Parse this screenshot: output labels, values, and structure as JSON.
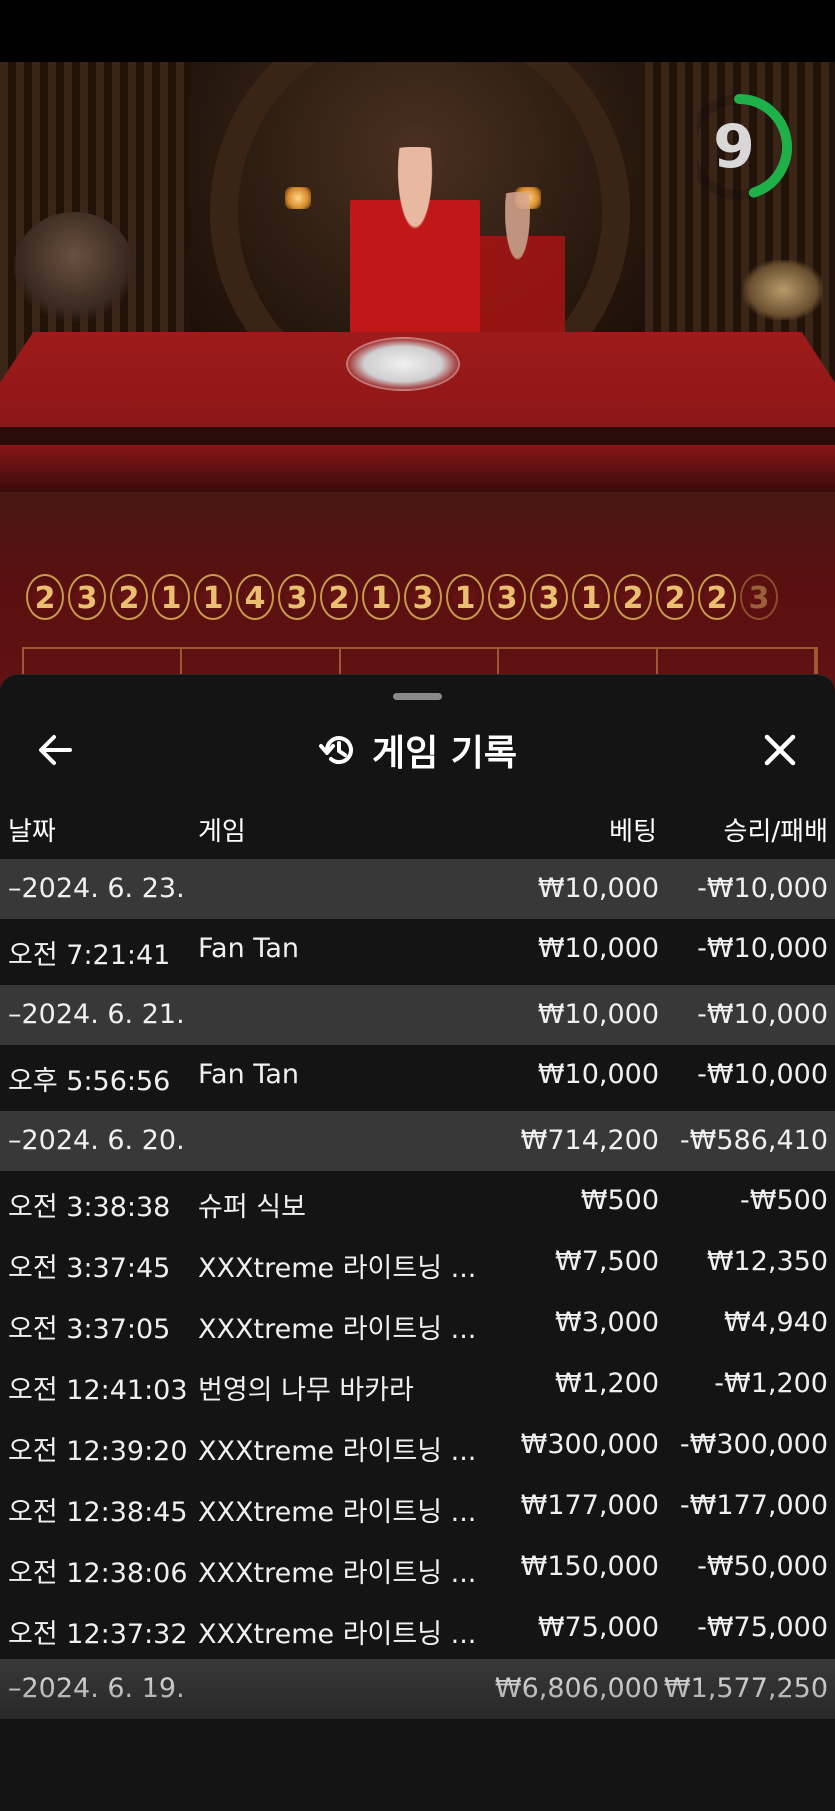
{
  "timer": {
    "value": "9",
    "fraction": 0.45,
    "color": "#1fb04a"
  },
  "road": [
    "2",
    "3",
    "2",
    "1",
    "1",
    "4",
    "3",
    "2",
    "1",
    "3",
    "1",
    "3",
    "3",
    "1",
    "2",
    "2",
    "2",
    "3"
  ],
  "sheet": {
    "title": "게임 기록",
    "back_icon": "arrow-left-icon",
    "title_icon": "history-icon",
    "close_icon": "close-icon",
    "columns": {
      "date": "날짜",
      "game": "게임",
      "bet": "베팅",
      "win_loss": "승리/패배"
    },
    "rows": [
      {
        "type": "day",
        "time": "–2024. 6. 23.",
        "game": "",
        "bet": "₩10,000",
        "win": "-₩10,000"
      },
      {
        "type": "entry",
        "time": "오전 7:21:41",
        "game": "Fan Tan",
        "bet": "₩10,000",
        "win": "-₩10,000"
      },
      {
        "type": "day",
        "time": "–2024. 6. 21.",
        "game": "",
        "bet": "₩10,000",
        "win": "-₩10,000"
      },
      {
        "type": "entry",
        "time": "오후 5:56:56",
        "game": "Fan Tan",
        "bet": "₩10,000",
        "win": "-₩10,000"
      },
      {
        "type": "day",
        "time": "–2024. 6. 20.",
        "game": "",
        "bet": "₩714,200",
        "win": "-₩586,410"
      },
      {
        "type": "entry",
        "time": "오전 3:38:38",
        "game": "슈퍼 식보",
        "bet": "₩500",
        "win": "-₩500"
      },
      {
        "type": "entry",
        "time": "오전 3:37:45",
        "game": "XXXtreme 라이트닝 ...",
        "bet": "₩7,500",
        "win": "₩12,350"
      },
      {
        "type": "entry",
        "time": "오전 3:37:05",
        "game": "XXXtreme 라이트닝 ...",
        "bet": "₩3,000",
        "win": "₩4,940"
      },
      {
        "type": "entry",
        "time": "오전 12:41:03",
        "game": "번영의 나무 바카라",
        "bet": "₩1,200",
        "win": "-₩1,200"
      },
      {
        "type": "entry",
        "time": "오전 12:39:20",
        "game": "XXXtreme 라이트닝 ...",
        "bet": "₩300,000",
        "win": "-₩300,000"
      },
      {
        "type": "entry",
        "time": "오전 12:38:45",
        "game": "XXXtreme 라이트닝 ...",
        "bet": "₩177,000",
        "win": "-₩177,000"
      },
      {
        "type": "entry",
        "time": "오전 12:38:06",
        "game": "XXXtreme 라이트닝 ...",
        "bet": "₩150,000",
        "win": "-₩50,000"
      },
      {
        "type": "entry",
        "time": "오전 12:37:32",
        "game": "XXXtreme 라이트닝 ...",
        "bet": "₩75,000",
        "win": "-₩75,000"
      },
      {
        "type": "day",
        "time": "–2024. 6. 19.",
        "game": "",
        "bet": "₩6,806,000",
        "win": "₩1,577,250"
      }
    ]
  }
}
